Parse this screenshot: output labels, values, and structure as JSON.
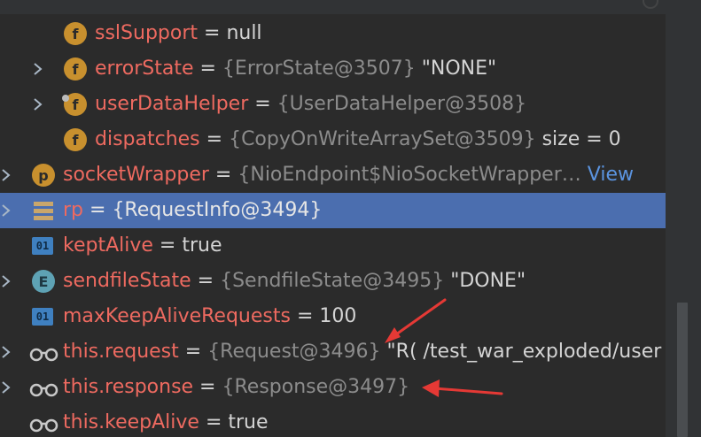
{
  "variables": [
    {
      "name": "sslSupport",
      "eq": " = ",
      "ref": "",
      "value": "null",
      "extra": "",
      "icon": "field-icon",
      "badge": "f",
      "expandable": false
    },
    {
      "name": "errorState",
      "eq": " = ",
      "ref": "{ErrorState@3507}",
      "value": " \"NONE\"",
      "extra": "",
      "icon": "field-icon",
      "badge": "f",
      "expandable": true
    },
    {
      "name": "userDataHelper",
      "eq": " = ",
      "ref": "{UserDataHelper@3508}",
      "value": "",
      "extra": "",
      "icon": "field-icon",
      "badge": "f",
      "expandable": true
    },
    {
      "name": "dispatches",
      "eq": " = ",
      "ref": "{CopyOnWriteArraySet@3509}",
      "value": "  size = 0",
      "extra": "",
      "icon": "field-icon",
      "badge": "f",
      "expandable": false
    },
    {
      "name": "socketWrapper",
      "eq": " = ",
      "ref": "{NioEndpoint$NioSocketWrapper…",
      "value": "",
      "extra": " View",
      "icon": "protected-field-icon",
      "badge": "p",
      "expandable": true
    },
    {
      "name": "rp",
      "eq": " = ",
      "ref": "{RequestInfo@3494}",
      "value": "",
      "extra": "",
      "icon": "object-icon",
      "badge": "",
      "expandable": true
    },
    {
      "name": "keptAlive",
      "eq": " = ",
      "ref": "",
      "value": "true",
      "extra": "",
      "icon": "primitive-icon",
      "badge": "01",
      "expandable": false
    },
    {
      "name": "sendfileState",
      "eq": " = ",
      "ref": "{SendfileState@3495}",
      "value": " \"DONE\"",
      "extra": "",
      "icon": "enum-icon",
      "badge": "E",
      "expandable": true
    },
    {
      "name": "maxKeepAliveRequests",
      "eq": " = ",
      "ref": "",
      "value": "100",
      "extra": "",
      "icon": "primitive-icon",
      "badge": "01",
      "expandable": false
    },
    {
      "name": "this.request",
      "eq": " = ",
      "ref": "{Request@3496}",
      "value": " \"R( /test_war_exploded/user",
      "extra": "",
      "icon": "watch-icon",
      "badge": "",
      "expandable": true
    },
    {
      "name": "this.response",
      "eq": " = ",
      "ref": "{Response@3497}",
      "value": "",
      "extra": "",
      "icon": "watch-icon",
      "badge": "",
      "expandable": true
    },
    {
      "name": "this.keepAlive",
      "eq": " = ",
      "ref": "",
      "value": "true",
      "extra": "",
      "icon": "watch-icon",
      "badge": "",
      "expandable": false
    }
  ],
  "colors": {
    "background": "#2b2b2b",
    "selection": "#4b6eaf",
    "name": "#ee6a60",
    "reference": "#8c8c8c",
    "value": "#d4d4d4",
    "link": "#5b94e0",
    "annotation_arrow": "#e53935"
  },
  "selected_index": 5
}
